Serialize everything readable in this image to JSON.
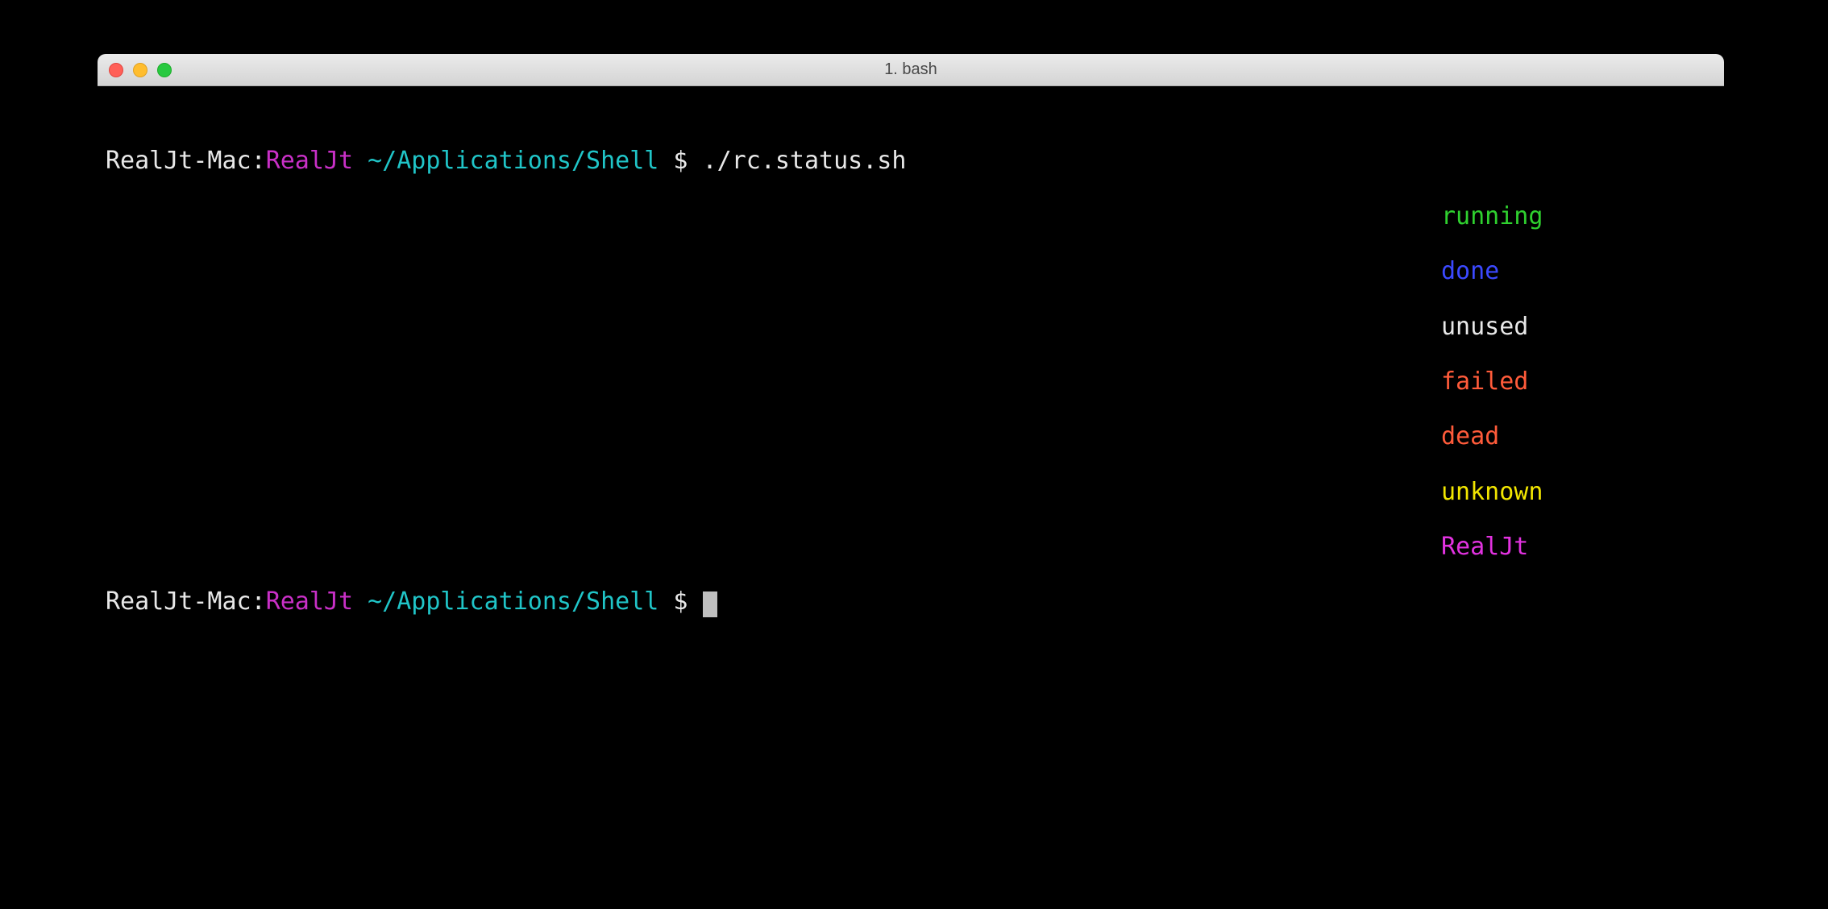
{
  "window": {
    "title": "1. bash"
  },
  "prompt": {
    "host": "RealJt-Mac",
    "colon": ":",
    "user": "RealJt",
    "path": "~/Applications/Shell",
    "dollar": "$"
  },
  "command": "./rc.status.sh",
  "statuses": [
    {
      "label": "running",
      "cls": "running"
    },
    {
      "label": "done",
      "cls": "done"
    },
    {
      "label": "unused",
      "cls": "unused"
    },
    {
      "label": "failed",
      "cls": "failed"
    },
    {
      "label": "dead",
      "cls": "dead"
    },
    {
      "label": "unknown",
      "cls": "unknown"
    },
    {
      "label": "RealJt",
      "cls": "realjt"
    }
  ]
}
